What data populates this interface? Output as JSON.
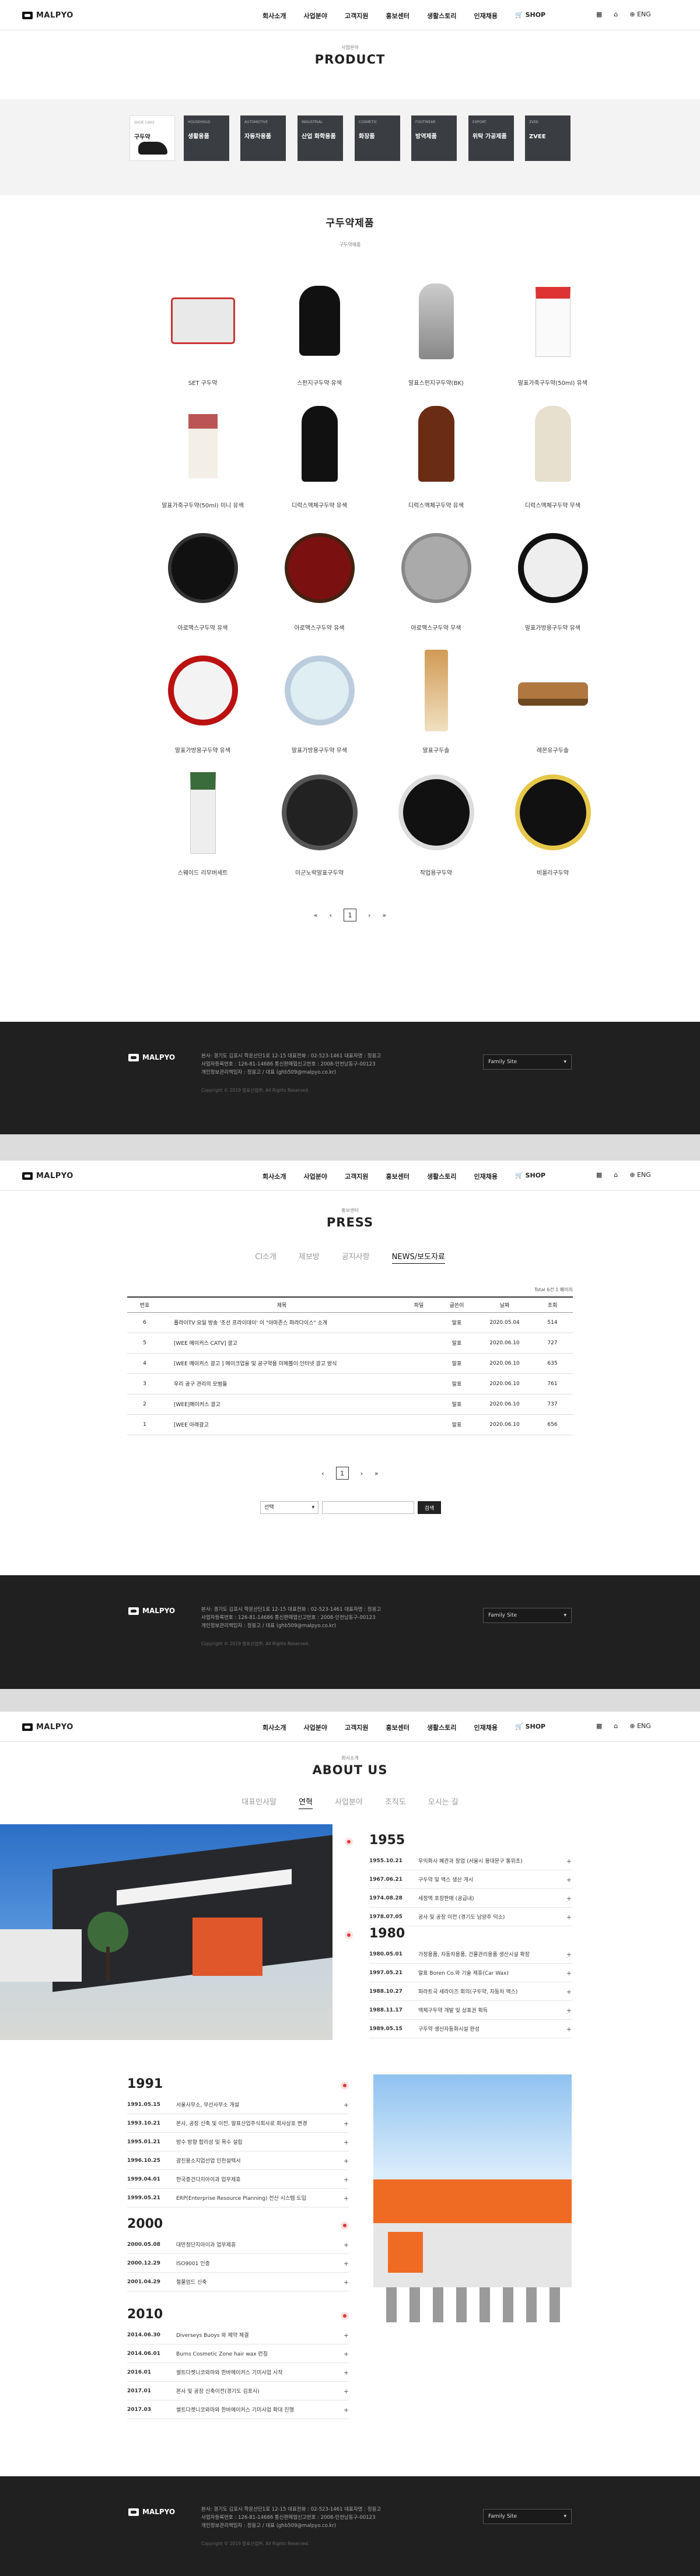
{
  "header": {
    "logo": "MALPYO",
    "nav": [
      "회사소개",
      "사업분야",
      "고객지원",
      "홍보센터",
      "생활스토리",
      "인재채용",
      "SHOP"
    ],
    "utility": {
      "menu_icon": "grid-icon",
      "home_icon": "home-icon",
      "lang": "ENG"
    }
  },
  "product_page": {
    "subtitle": "사업분야",
    "title": "PRODUCT",
    "categories": [
      {
        "en": "SHOE CARE",
        "ko": "구두약"
      },
      {
        "en": "HOUSEHOLD",
        "ko": "생활용품"
      },
      {
        "en": "AUTOMOTIVE",
        "ko": "자동차용품"
      },
      {
        "en": "INDUSTRIAL",
        "ko": "산업 화학용품"
      },
      {
        "en": "COSMETIC",
        "ko": "화장품"
      },
      {
        "en": "FOOTWEAR",
        "ko": "방역제품"
      },
      {
        "en": "EXPORT",
        "ko": "위탁 가공제품"
      },
      {
        "en": "ZVEE",
        "ko": "ZVEE"
      }
    ],
    "section_title": "구두약제품",
    "section_sub": "구두약제품",
    "products": [
      "SET 구두약",
      "스펀지구두약 유색",
      "말표스펀지구두약(BK)",
      "말표가죽구두약(50ml) 유색",
      "말표가죽구두약(50ml) 미니 유색",
      "디럭스액체구두약 유색",
      "디럭스액체구두약 유색",
      "디럭스액체구두약 무색",
      "아로맥스구두약 유색",
      "아로맥스구두약 유색",
      "아로맥스구두약 무색",
      "말표가방용구두약 유색",
      "말표가방용구두약 유색",
      "말표가방용구두약 무색",
      "말표구두솔",
      "레몬유구두솔",
      "스웨이드 리무버세트",
      "미군노락말표구두약",
      "작업용구두약",
      "비올리구두약"
    ],
    "pager": {
      "first": "«",
      "prev": "‹",
      "current": "1",
      "next": "›",
      "last": "»"
    }
  },
  "press_page": {
    "subtitle": "홍보센터",
    "title": "PRESS",
    "tabs": [
      "CI소개",
      "제보방",
      "공지사항",
      "NEWS/보도자료"
    ],
    "active_tab": "NEWS/보도자료",
    "total": "Total 6건 1 페이지",
    "columns": [
      "번호",
      "제목",
      "파일",
      "글쓴이",
      "날짜",
      "조회"
    ],
    "rows": [
      {
        "no": "6",
        "title": "플라이TV 요일 방송 '조선 프라이데이' 이 \"아마존스 파라다이스\" 소개",
        "file": "",
        "writer": "말표",
        "date": "2020.05.04",
        "views": "514"
      },
      {
        "no": "5",
        "title": "[WEE 메이커스 CATV] 광고",
        "file": "",
        "writer": "말표",
        "date": "2020.06.10",
        "views": "727"
      },
      {
        "no": "4",
        "title": "[WEE 메이커스 광고 ] 메이크업을 및 공구약용 미메볼이 인터넷 광고 방식",
        "file": "",
        "writer": "말표",
        "date": "2020.06.10",
        "views": "635"
      },
      {
        "no": "3",
        "title": "우리 공구 관리의 모범들",
        "file": "",
        "writer": "말표",
        "date": "2020.06.10",
        "views": "761"
      },
      {
        "no": "2",
        "title": "[WEE]메이커스 광고",
        "file": "",
        "writer": "말표",
        "date": "2020.06.10",
        "views": "737"
      },
      {
        "no": "1",
        "title": "[WEE 아래광고",
        "file": "",
        "writer": "말표",
        "date": "2020.06.10",
        "views": "656"
      }
    ],
    "pager": {
      "prev": "‹",
      "current": "1",
      "next": "›",
      "last": "»"
    },
    "search": {
      "select": "선택",
      "placeholder": "",
      "button": "검색"
    }
  },
  "about_page": {
    "subtitle": "회사소개",
    "title": "ABOUT US",
    "tabs": [
      "대표인사말",
      "연혁",
      "사업분야",
      "조직도",
      "오시는 길"
    ],
    "active_tab": "연혁",
    "history": [
      {
        "year": "1955",
        "events": [
          {
            "date": "1955.10.21",
            "text": "우익화사 폐관과 창업 (서울시 용대문구 통위초)"
          },
          {
            "date": "1967.06.21",
            "text": "구두약 및 액스 생산 개시"
          },
          {
            "date": "1974.08.28",
            "text": "세정액 포장판매 (공급내)"
          },
          {
            "date": "1978.07.05",
            "text": "공사 및 공장 이전 (경기도 남양주 덕소)"
          }
        ]
      },
      {
        "year": "1980",
        "events": [
          {
            "date": "1980.05.01",
            "text": "가정용품, 자동차용품, 건물관리용품 생산시설 확장"
          },
          {
            "date": "1997.05.21",
            "text": "말표 Boren Co.와 기술 제휴(Car Wax)"
          },
          {
            "date": "1988.10.27",
            "text": "파라트국 세라이즈 회의(구두약, 자동차 액스)"
          },
          {
            "date": "1988.11.17",
            "text": "액체구두약 개발 및 상표권 획득"
          },
          {
            "date": "1989.05.15",
            "text": "구두약 생산자동화시설 완성"
          }
        ]
      },
      {
        "year": "1991",
        "events": [
          {
            "date": "1991.05.15",
            "text": "서울사무소, 무선사무소 개설"
          },
          {
            "date": "1993.10.21",
            "text": "본사, 공장 신축 및 이전, 말표산업주식회사로 회사상호 변경"
          },
          {
            "date": "1995.01.21",
            "text": "방수 방향 합리성 및 목수 설립"
          },
          {
            "date": "1996.10.25",
            "text": "광진용소지업선업 인천설텍서"
          },
          {
            "date": "1999.04.01",
            "text": "한국증건다지아이과 업무제휴"
          },
          {
            "date": "1999.05.21",
            "text": "ERP(Enterprise Resource Planning) 전산 시스템 도입"
          }
        ]
      },
      {
        "year": "2000",
        "events": [
          {
            "date": "2000.05.08",
            "text": "대만정단지아이과 업무제휴"
          },
          {
            "date": "2000.12.29",
            "text": "ISO9001 인증"
          },
          {
            "date": "2001.04.29",
            "text": "철물엄드 신축"
          }
        ]
      },
      {
        "year": "2010",
        "events": [
          {
            "date": "2014.06.30",
            "text": "Diverseys Buoys 와 제약 체결"
          },
          {
            "date": "2014.06.01",
            "text": "Burns Cosmetic Zone hair wax 런칭"
          },
          {
            "date": "2016.01",
            "text": "썰트다켓니코와마와 한바메이커스 기미사업 시작"
          },
          {
            "date": "2017.01",
            "text": "본사 및 공장 신축이전(경기도 김포시)"
          },
          {
            "date": "2017.03",
            "text": "썰트다켓니코와마와 한바메이커스 기미사업 확대 진행"
          }
        ]
      }
    ]
  },
  "footer": {
    "logo": "MALPYO",
    "info": [
      "본사: 경기도 김포시 학운산단1로 12-15   대표전화 : 02-523-1461   대표자명 : 정용고",
      "사업자등록번호 : 126-81-14686   통신판매업신고번호 : 2008-인천남동구-00123",
      "개인정보관리책임자 : 정용고 / 대표 (ghb509@malpyo.co.kr)"
    ],
    "copyright": "Copyright © 2019 말표산업㈜. All Rights Reserved.",
    "family_site": "Family Site"
  },
  "colors": {
    "accent": "#e03a3a",
    "footer_bg": "#202020",
    "category_dark": "#3a3d42"
  }
}
